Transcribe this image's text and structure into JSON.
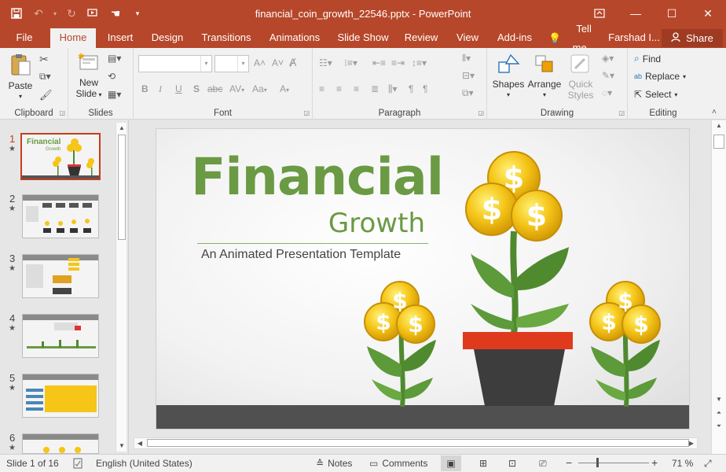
{
  "window": {
    "title": "financial_coin_growth_22546.pptx - PowerPoint"
  },
  "tabs": [
    "File",
    "Home",
    "Insert",
    "Design",
    "Transitions",
    "Animations",
    "Slide Show",
    "Review",
    "View",
    "Add-ins"
  ],
  "tell_me": "Tell me...",
  "user": "Farshad I...",
  "share_label": "Share",
  "ribbon": {
    "clipboard": {
      "label": "Clipboard",
      "paste": "Paste"
    },
    "slides": {
      "label": "Slides",
      "new_slide": "New",
      "new_slide2": "Slide"
    },
    "font": {
      "label": "Font",
      "bold": "B",
      "italic": "I",
      "underline": "U",
      "shadow": "S",
      "strike": "abc",
      "spacing": "AV",
      "case": "Aa"
    },
    "paragraph": {
      "label": "Paragraph"
    },
    "drawing": {
      "label": "Drawing",
      "shapes": "Shapes",
      "arrange": "Arrange",
      "quick1": "Quick",
      "quick2": "Styles"
    },
    "editing": {
      "label": "Editing",
      "find": "Find",
      "replace": "Replace",
      "select": "Select"
    }
  },
  "slides": [
    {
      "num": "1",
      "star": "★"
    },
    {
      "num": "2",
      "star": "★"
    },
    {
      "num": "3",
      "star": "★"
    },
    {
      "num": "4",
      "star": "★"
    },
    {
      "num": "5",
      "star": "★"
    },
    {
      "num": "6",
      "star": "★"
    }
  ],
  "slide_content": {
    "title": "Financial",
    "subtitle": "Growth",
    "tagline": "An Animated Presentation Template",
    "thumb1_title": "Financial",
    "thumb1_sub": "Growth"
  },
  "status": {
    "slide_counter": "Slide 1 of 16",
    "language": "English (United States)",
    "notes": "Notes",
    "comments": "Comments",
    "zoom": "71 %",
    "zoom_level_percent": 71
  },
  "colors": {
    "accent": "#b7472a",
    "title_green": "#6a9a43",
    "coin_gold": "#f5c518"
  }
}
